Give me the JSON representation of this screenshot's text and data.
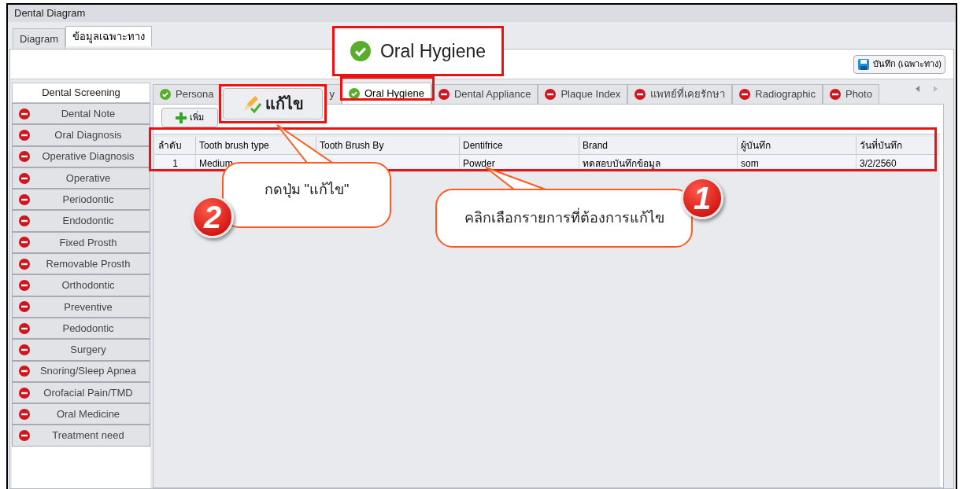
{
  "window": {
    "title": "Dental Diagram"
  },
  "top_tabs": [
    {
      "label": "Diagram",
      "selected": false
    },
    {
      "label": "ข้อมูลเฉพาะทาง",
      "selected": true
    }
  ],
  "save_button": {
    "label": "บันทึก (เฉพาะทาง)"
  },
  "sidebar": {
    "header": "Dental Screening",
    "items": [
      {
        "label": "Dental Note",
        "completed": false
      },
      {
        "label": "Oral Diagnosis",
        "completed": false
      },
      {
        "label": "Operative Diagnosis",
        "completed": false
      },
      {
        "label": "Operative",
        "completed": false
      },
      {
        "label": "Periodontic",
        "completed": false
      },
      {
        "label": "Endodontic",
        "completed": false
      },
      {
        "label": "Fixed Prosth",
        "completed": false
      },
      {
        "label": "Removable Prosth",
        "completed": false
      },
      {
        "label": "Orthodontic",
        "completed": false
      },
      {
        "label": "Preventive",
        "completed": false
      },
      {
        "label": "Pedodontic",
        "completed": false
      },
      {
        "label": "Surgery",
        "completed": false
      },
      {
        "label": "Snoring/Sleep Apnea",
        "completed": false
      },
      {
        "label": "Orofacial Pain/TMD",
        "completed": false
      },
      {
        "label": "Oral Medicine",
        "completed": false
      },
      {
        "label": "Treatment need",
        "completed": false
      }
    ]
  },
  "tabs": [
    {
      "label": "Persona",
      "completed": true,
      "selected": false
    },
    {
      "label": "y",
      "selected": false
    },
    {
      "label": "Oral Hygiene",
      "completed": true,
      "selected": true
    },
    {
      "label": "Dental Appliance",
      "completed": false,
      "selected": false
    },
    {
      "label": "Plaque Index",
      "completed": false,
      "selected": false
    },
    {
      "label": "แพทย์ที่เคยรักษา",
      "completed": false,
      "selected": false
    },
    {
      "label": "Radiographic",
      "completed": false,
      "selected": false
    },
    {
      "label": "Photo",
      "completed": false,
      "selected": false
    }
  ],
  "add_button": {
    "label": "เพิ่ม"
  },
  "grid": {
    "columns": [
      "ลำดับ",
      "Tooth brush type",
      "Tooth Brush By",
      "Dentifrice",
      "Brand",
      "ผู้บันทึก",
      "วันที่บันทึก"
    ],
    "rows": [
      {
        "cells": [
          "1",
          "Medium",
          null,
          "Powder",
          "ทดสอบบันทึกข้อมูล",
          "som",
          "3/2/2560"
        ]
      }
    ]
  },
  "callouts": {
    "zoomed_tab": {
      "label": "Oral Hygiene",
      "completed": true
    },
    "zoomed_button": {
      "label": "แก้ไข"
    },
    "steps": [
      {
        "number": "2",
        "text": "กดปุ่ม \"แก้ไข\""
      },
      {
        "number": "1",
        "text": "คลิกเลือกรายการที่ต้องการแก้ไข"
      }
    ]
  }
}
